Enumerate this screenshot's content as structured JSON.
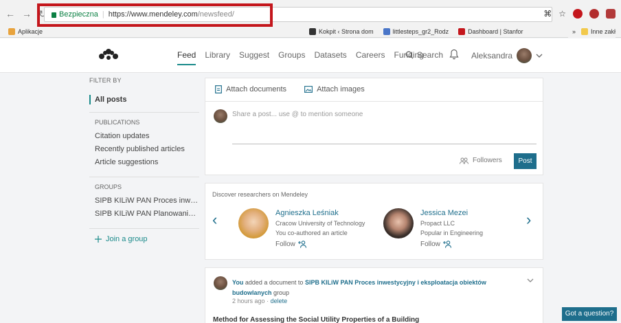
{
  "browser": {
    "secure_label": "Bezpieczna",
    "url_host": "https://www.mendeley.com",
    "url_path": "/newsfeed/",
    "bookmarks": [
      {
        "label": "Aplikacje",
        "color": "#e8a33d"
      },
      {
        "label": "Kokpit ‹ Strona dom",
        "color": "#333333"
      },
      {
        "label": "littlesteps_gr2_Rodz",
        "color": "#4a76c8"
      },
      {
        "label": "Dashboard | Stanfor",
        "color": "#c4161c"
      }
    ],
    "bookmarks_overflow": "»",
    "other_bookmarks": "Inne zakł"
  },
  "header": {
    "nav": [
      {
        "label": "Feed",
        "active": true
      },
      {
        "label": "Library"
      },
      {
        "label": "Suggest"
      },
      {
        "label": "Groups"
      },
      {
        "label": "Datasets"
      },
      {
        "label": "Careers"
      },
      {
        "label": "Funding"
      }
    ],
    "search_label": "Search",
    "user_name": "Aleksandra"
  },
  "sidebar": {
    "filter_heading": "FILTER BY",
    "all_posts": "All posts",
    "publications_heading": "PUBLICATIONS",
    "publications": [
      "Citation updates",
      "Recently published articles",
      "Article suggestions"
    ],
    "groups_heading": "GROUPS",
    "groups": [
      "SIPB KILiW PAN Proces inwestycyjny...",
      "SIPB KILiW PAN Planowanie, ry..."
    ],
    "join_group": "Join a group"
  },
  "composer": {
    "attach_documents": "Attach documents",
    "attach_images": "Attach images",
    "placeholder": "Share a post... use @ to mention someone",
    "followers_label": "Followers",
    "post_label": "Post"
  },
  "discover": {
    "title": "Discover researchers on Mendeley",
    "researchers": [
      {
        "name": "Agnieszka Leśniak",
        "line1": "Cracow University of Technology",
        "line2": "You co-authored an article",
        "follow": "Follow"
      },
      {
        "name": "Jessica Mezei",
        "line1": "Propact LLC",
        "line2": "Popular in Engineering",
        "follow": "Follow"
      }
    ]
  },
  "activity": {
    "you": "You",
    "action": "added a document to",
    "group_name": "SIPB KILiW PAN Proces inwestycyjny i eksploatacja obiektów budowlanych",
    "group_suffix": "group",
    "time": "2 hours ago",
    "time_sep": "·",
    "delete": "delete",
    "document_title": "Method for Assessing the Social Utility Properties of a Building"
  },
  "help": {
    "label": "Got a question?"
  },
  "colors": {
    "accent": "#1e6e8c",
    "teal": "#1a8a8a",
    "highlight": "#c4161c"
  }
}
